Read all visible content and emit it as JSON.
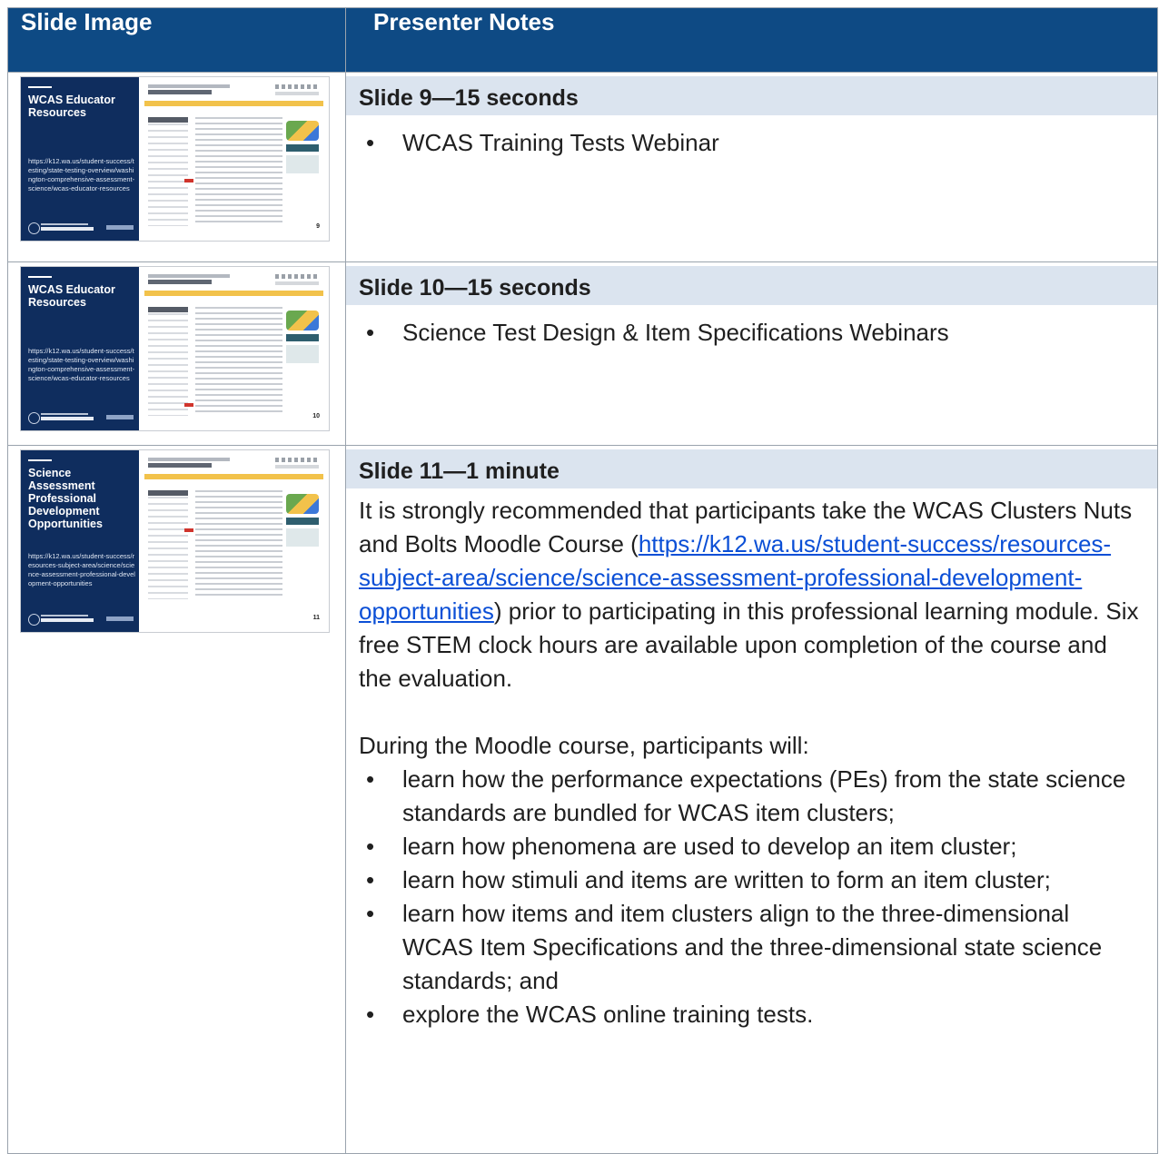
{
  "table": {
    "header": {
      "col1": "Slide Image",
      "col2": "Presenter Notes"
    }
  },
  "rows": [
    {
      "thumb": {
        "title": "WCAS Educator Resources",
        "url": "https://k12.wa.us/student-success/testing/state-testing-overview/washington-comprehensive-assessment-science/wcas-educator-resources",
        "page": "9"
      },
      "heading": "Slide 9—15 seconds",
      "bullets": [
        "WCAS Training Tests Webinar"
      ]
    },
    {
      "thumb": {
        "title": "WCAS Educator Resources",
        "url": "https://k12.wa.us/student-success/testing/state-testing-overview/washington-comprehensive-assessment-science/wcas-educator-resources",
        "page": "10"
      },
      "heading": "Slide 10—15 seconds",
      "bullets": [
        "Science Test Design & Item Specifications Webinars"
      ]
    },
    {
      "thumb": {
        "title": "Science Assessment Professional Development Opportunities",
        "url": "https://k12.wa.us/student-success/resources-subject-area/science/science-assessment-professional-development-opportunities",
        "page": "11"
      },
      "heading": "Slide 11—1 minute",
      "para_before_link": "It is strongly recommended that participants take the WCAS Clusters Nuts and Bolts Moodle Course (",
      "link": "https://k12.wa.us/student-success/resources-subject-area/science/science-assessment-professional-development-opportunities",
      "para_after_link": ") prior to participating in this professional learning module. Six free STEM clock hours are available upon completion of the course and the evaluation.",
      "intro": "During the Moodle course, participants will:",
      "bullets": [
        "learn how the performance expectations (PEs) from the state science standards are bundled for WCAS item clusters;",
        "learn how phenomena are used to develop an item cluster;",
        "learn how stimuli and items are written to form an item cluster;",
        "learn how items and item clusters align to the three-dimensional WCAS Item Specifications and the three-dimensional state science standards; and",
        "explore the WCAS online training tests."
      ]
    }
  ]
}
